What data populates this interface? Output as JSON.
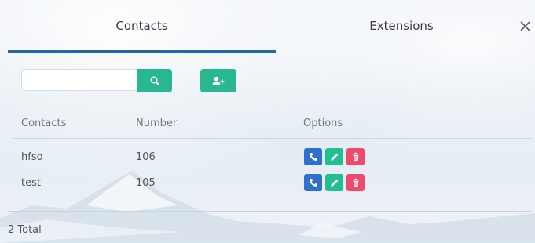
{
  "tabs": [
    {
      "label": "Contacts",
      "active": true
    },
    {
      "label": "Extensions",
      "active": false
    }
  ],
  "close_label": "×",
  "search": {
    "value": "",
    "placeholder": "",
    "button_icon": "search-icon"
  },
  "toolbar": {
    "add_contact_icon": "add-user-icon"
  },
  "table": {
    "headers": {
      "name": "Contacts",
      "number": "Number",
      "options": "Options"
    },
    "rows": [
      {
        "name": "hfso",
        "number": "106"
      },
      {
        "name": "test",
        "number": "105"
      }
    ],
    "row_actions": [
      "call-icon",
      "edit-icon",
      "delete-icon"
    ]
  },
  "footer": {
    "total": "2 Total"
  },
  "colors": {
    "tab_active_underline": "#2765a3",
    "primary_green": "#27b891",
    "call_blue": "#2f6fd0",
    "edit_green": "#21bf8f",
    "delete_red": "#ee4a6c"
  }
}
